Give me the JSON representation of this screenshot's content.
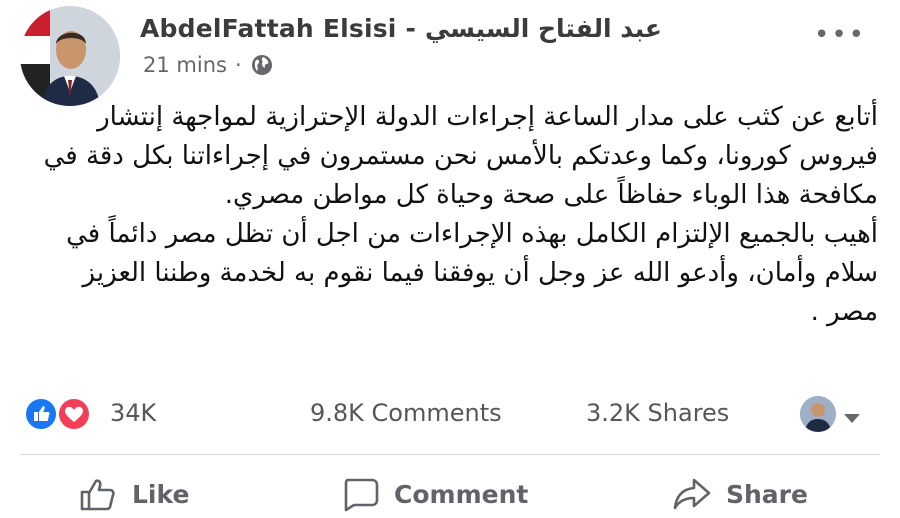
{
  "post": {
    "author": "AbdelFattah Elsisi - عبد الفتاح السيسي",
    "time": "21 mins",
    "separator": "·",
    "privacy_icon": "globe-icon",
    "more_icon": "•••",
    "paragraphs": [
      "أتابع عن كثب على مدار الساعة إجراءات الدولة الإحترازية لمواجهة إنتشار فيروس كورونا، وكما وعدتكم بالأمس نحن مستمرون في إجراءاتنا بكل دقة في مكافحة هذا الوباء حفاظاً على صحة وحياة كل مواطن مصري.",
      "أهيب بالجميع الإلتزام الكامل بهذه الإجراءات من اجل أن تظل مصر دائماً في سلام وأمان، وأدعو الله عز وجل أن يوفقنا فيما نقوم به لخدمة وطننا العزيز مصر ."
    ]
  },
  "stats": {
    "reactions_count": "34K",
    "comments": "9.8K Comments",
    "shares": "3.2K Shares"
  },
  "actions": {
    "like": "Like",
    "comment": "Comment",
    "share": "Share"
  },
  "colors": {
    "like_blue": "#1877f2",
    "love_red": "#f33e58",
    "muted_text": "#65676b"
  }
}
